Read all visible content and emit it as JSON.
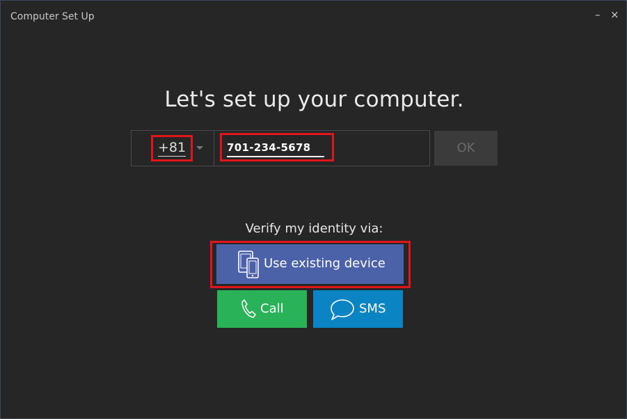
{
  "window": {
    "title": "Computer Set Up",
    "minimize_glyph": "–",
    "close_glyph": "×"
  },
  "heading": "Let's set up your computer.",
  "phone": {
    "country_code": "+81",
    "number": "701-234-5678"
  },
  "ok_label": "OK",
  "verify": {
    "label": "Verify my identity via:",
    "device_button": "Use existing device",
    "call_button": "Call",
    "sms_button": "SMS"
  },
  "icons": {
    "device": "devices-icon",
    "call": "phone-icon",
    "sms": "chat-bubble-icon"
  },
  "colors": {
    "background": "#262626",
    "device_button": "#4b62a9",
    "call_button": "#29b257",
    "sms_button": "#0b84c3",
    "highlight": "#e0161c",
    "ok_disabled": "#3b3b3b"
  }
}
